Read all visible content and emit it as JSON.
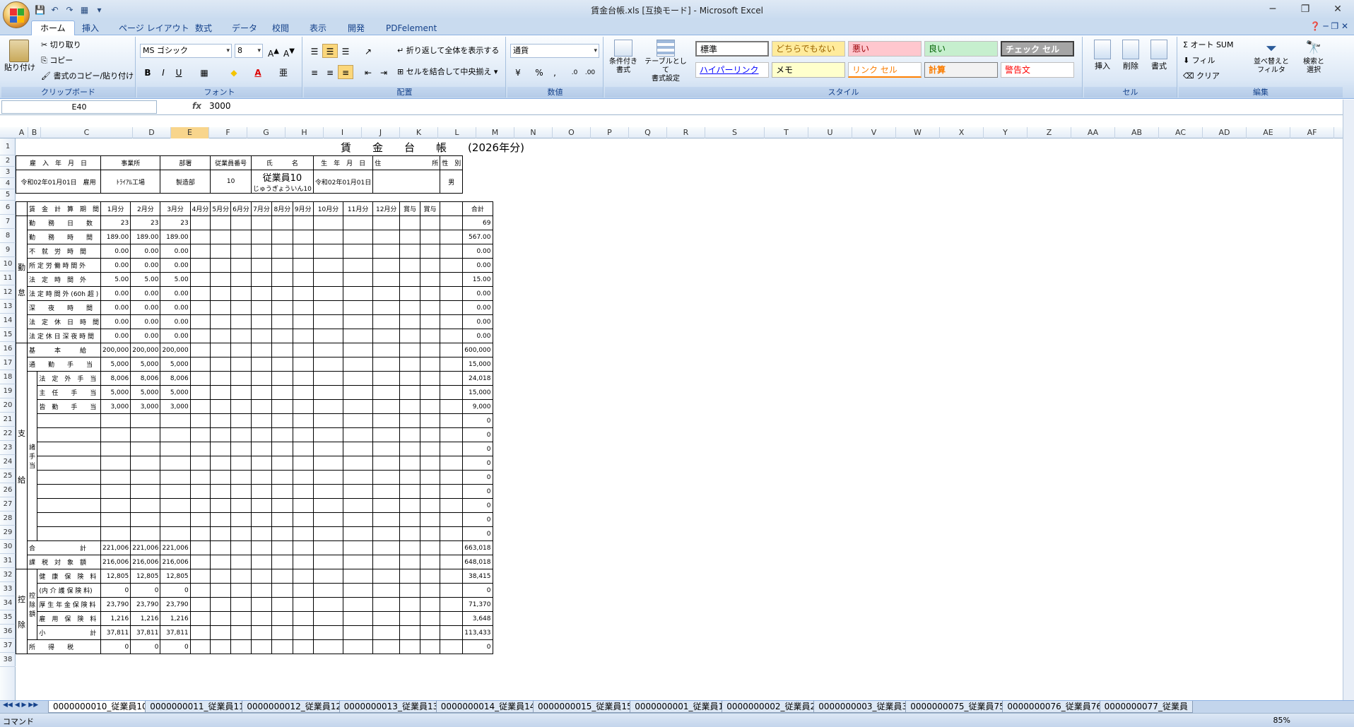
{
  "window": {
    "title": "賃金台帳.xls  [互換モード] - Microsoft Excel"
  },
  "ribbon": {
    "tabs": [
      "ホーム",
      "挿入",
      "ページ レイアウト",
      "数式",
      "データ",
      "校閲",
      "表示",
      "開発",
      "PDFelement"
    ],
    "clipboard": {
      "paste": "貼り付け",
      "cut": "切り取り",
      "copy": "コピー",
      "format_painter": "書式のコピー/貼り付け",
      "label": "クリップボード"
    },
    "font": {
      "name": "MS ゴシック",
      "size": "8",
      "label": "フォント"
    },
    "align": {
      "wrap": "折り返して全体を表示する",
      "merge": "セルを結合して中央揃え",
      "label": "配置"
    },
    "number": {
      "format": "通貨",
      "label": "数値"
    },
    "styles": {
      "cond": "条件付き\n書式",
      "table": "テーブルとして\n書式設定",
      "cells": [
        "標準",
        "どちらでもない",
        "悪い",
        "良い",
        "チェック セル",
        "ハイパーリンク",
        "メモ",
        "リンク セル",
        "計算",
        "警告文"
      ],
      "label": "スタイル"
    },
    "cells": {
      "insert": "挿入",
      "delete": "削除",
      "format": "書式",
      "label": "セル"
    },
    "edit": {
      "autosum": "Σ オート SUM",
      "fill": "フィル",
      "clear": "クリア",
      "sort": "並べ替えと\nフィルタ",
      "find": "検索と\n選択",
      "label": "編集"
    }
  },
  "formula": {
    "namebox": "E40",
    "value": "3000"
  },
  "columns": [
    "A",
    "B",
    "C",
    "D",
    "E",
    "F",
    "G",
    "H",
    "I",
    "J",
    "K",
    "L",
    "M",
    "N",
    "O",
    "P",
    "Q",
    "R",
    "S",
    "T",
    "U",
    "V",
    "W",
    "X",
    "Y",
    "Z",
    "AA",
    "AB",
    "AC",
    "AD",
    "AE",
    "AF"
  ],
  "rows": [
    "1",
    "2",
    "3",
    "4",
    "5",
    "6",
    "7",
    "8",
    "9",
    "10",
    "11",
    "12",
    "13",
    "14",
    "15",
    "16",
    "17",
    "18",
    "19",
    "20",
    "21",
    "22",
    "23",
    "24",
    "25",
    "26",
    "27",
    "28",
    "29",
    "30",
    "31",
    "32",
    "33",
    "34",
    "35",
    "36",
    "37",
    "38"
  ],
  "sheet": {
    "title": "賃　　金　　台　　帳　　(2026年分)",
    "header": [
      "雇　入　年　月　日",
      "事業所",
      "部署",
      "従業員番号",
      "氏　　　名",
      "生　年　月　日",
      "住　　　　　　　　所",
      "性　別"
    ],
    "hire": "令和02年01月01日　雇用",
    "office": "ﾄﾗｲｱﾙ工場",
    "dept": "製造部",
    "empno": "10",
    "name": "従業員10",
    "kana": "じゅうぎょういん10",
    "birth": "令和02年01月01日",
    "sex": "男",
    "months": [
      "賃　金　計　算　期　間",
      "1月分",
      "2月分",
      "3月分",
      "4月分",
      "5月分",
      "6月分",
      "7月分",
      "8月分",
      "9月分",
      "10月分",
      "11月分",
      "12月分",
      "賞与",
      "賞与",
      "",
      "合計"
    ],
    "rows": [
      [
        "勤　　務　　日　　数",
        "23",
        "23",
        "23",
        "69"
      ],
      [
        "勤　　務　　時　　間",
        "189.00",
        "189.00",
        "189.00",
        "567.00"
      ],
      [
        "不　就　労　時　間",
        "0.00",
        "0.00",
        "0.00",
        "0.00"
      ],
      [
        "所 定 労 働 時 間 外",
        "0.00",
        "0.00",
        "0.00",
        "0.00"
      ],
      [
        "法　定　時　間　外",
        "5.00",
        "5.00",
        "5.00",
        "15.00"
      ],
      [
        "法 定 時 間 外 (60h 超 )",
        "0.00",
        "0.00",
        "0.00",
        "0.00"
      ],
      [
        "深　　夜　　時　　間",
        "0.00",
        "0.00",
        "0.00",
        "0.00"
      ],
      [
        "法　定　休　日　時　間",
        "0.00",
        "0.00",
        "0.00",
        "0.00"
      ],
      [
        "法 定 休 日 深 夜 時 間",
        "0.00",
        "0.00",
        "0.00",
        "0.00"
      ],
      [
        "基　　　本　　　給",
        "200,000",
        "200,000",
        "200,000",
        "600,000"
      ],
      [
        "通　　勤　　手　　当",
        "5,000",
        "5,000",
        "5,000",
        "15,000"
      ],
      [
        "法　定　外　手　当",
        "8,006",
        "8,006",
        "8,006",
        "24,018"
      ],
      [
        "主　任　　手　　当",
        "5,000",
        "5,000",
        "5,000",
        "15,000"
      ],
      [
        "皆　勤　　手　　当",
        "3,000",
        "3,000",
        "3,000",
        "9,000"
      ],
      [
        "",
        "",
        "",
        "",
        "0"
      ],
      [
        "",
        "",
        "",
        "",
        "0"
      ],
      [
        "",
        "",
        "",
        "",
        "0"
      ],
      [
        "",
        "",
        "",
        "",
        "0"
      ],
      [
        "",
        "",
        "",
        "",
        "0"
      ],
      [
        "",
        "",
        "",
        "",
        "0"
      ],
      [
        "",
        "",
        "",
        "",
        "0"
      ],
      [
        "",
        "",
        "",
        "",
        "0"
      ],
      [
        "",
        "",
        "",
        "",
        "0"
      ],
      [
        "合　　　　　　　計",
        "221,006",
        "221,006",
        "221,006",
        "663,018"
      ],
      [
        "課　税　対　象　額",
        "216,006",
        "216,006",
        "216,006",
        "648,018"
      ],
      [
        "健　康　保　険　料",
        "12,805",
        "12,805",
        "12,805",
        "38,415"
      ],
      [
        "(内 介 護 保 険 料)",
        "0",
        "0",
        "0",
        "0"
      ],
      [
        "厚 生 年 金 保 険 料",
        "23,790",
        "23,790",
        "23,790",
        "71,370"
      ],
      [
        "雇　用　保　険　料",
        "1,216",
        "1,216",
        "1,216",
        "3,648"
      ],
      [
        "小　　　　　　　計",
        "37,811",
        "37,811",
        "37,811",
        "113,433"
      ],
      [
        "所　　得　　税",
        "0",
        "0",
        "0",
        "0"
      ]
    ],
    "sidelabels": {
      "work": "勤",
      "rest": "怠",
      "pay": "支",
      "pay2": "給",
      "allow": "諸\n手\n当",
      "ded": "控",
      "ded2": "除",
      "social": "控\n除\n額"
    }
  },
  "sheettabs": [
    "0000000010_従業員10",
    "0000000011_従業員11",
    "0000000012_従業員12",
    "0000000013_従業員13",
    "0000000014_従業員14",
    "0000000015_従業員15",
    "0000000001_従業員1",
    "0000000002_従業員2",
    "0000000003_従業員3",
    "0000000075_従業員75",
    "0000000076_従業員76",
    "0000000077_従業員"
  ],
  "status": {
    "mode": "コマンド",
    "zoom": "85%"
  }
}
